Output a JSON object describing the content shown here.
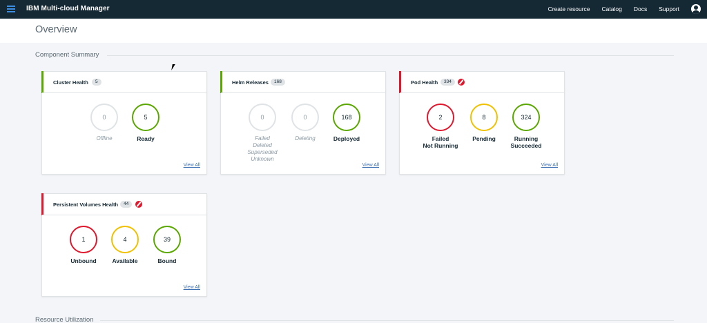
{
  "app": {
    "title": "IBM Multi-cloud Manager"
  },
  "nav": {
    "links": [
      "Create resource",
      "Catalog",
      "Docs",
      "Support"
    ]
  },
  "page": {
    "title": "Overview"
  },
  "sections": {
    "component_summary": "Component Summary",
    "resource_utilization": "Resource Utilization"
  },
  "view_all_label": "View All",
  "colors": {
    "green": "#5aa700",
    "yellow": "#efc100",
    "red": "#e0182d",
    "grey": "#dfe3e6",
    "link": "#3d70b2"
  },
  "cards": {
    "cluster": {
      "title": "Cluster Health",
      "count": "5",
      "status": "green",
      "stats": [
        {
          "value": "0",
          "label": "Offline"
        },
        {
          "value": "5",
          "label": "Ready"
        }
      ]
    },
    "helm": {
      "title": "Helm Releases",
      "count": "168",
      "status": "green",
      "stats": [
        {
          "value": "0",
          "label": "Failed\nDeleted\nSuperseded\nUnknown"
        },
        {
          "value": "0",
          "label": "Deleting"
        },
        {
          "value": "168",
          "label": "Deployed"
        }
      ]
    },
    "pod": {
      "title": "Pod Health",
      "count": "334",
      "status": "red",
      "stats": [
        {
          "value": "2",
          "label": "Failed\nNot Running"
        },
        {
          "value": "8",
          "label": "Pending"
        },
        {
          "value": "324",
          "label": "Running\nSucceeded"
        }
      ]
    },
    "pv": {
      "title": "Persistent Volumes Health",
      "count": "44",
      "status": "red",
      "stats": [
        {
          "value": "1",
          "label": "Unbound"
        },
        {
          "value": "4",
          "label": "Available"
        },
        {
          "value": "39",
          "label": "Bound"
        }
      ]
    }
  }
}
